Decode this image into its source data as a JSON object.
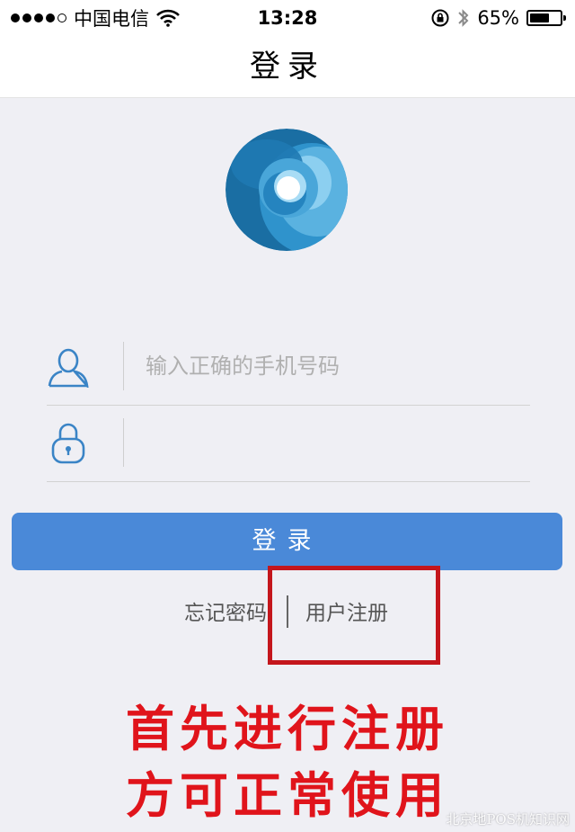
{
  "status_bar": {
    "carrier": "中国电信",
    "time": "13:28",
    "battery_percent": "65%",
    "battery_level": 0.65,
    "icons": [
      "signal-dots",
      "wifi-icon",
      "rotation-lock-icon",
      "bluetooth-icon",
      "battery-icon"
    ]
  },
  "nav": {
    "title": "登录"
  },
  "form": {
    "phone_placeholder": "输入正确的手机号码",
    "phone_value": "",
    "password_value": "",
    "login_label": "登录"
  },
  "links": {
    "forgot": "忘记密码",
    "register": "用户注册"
  },
  "overlay": {
    "caption_line1": "首先进行注册",
    "caption_line2": "方可正常使用",
    "watermark": "北京地POS机知识网"
  },
  "colors": {
    "accent": "#4a89d8",
    "logo_dark": "#1a6ea3",
    "logo_light": "#7cc4ea",
    "highlight": "#c4161c",
    "caption": "#e0141b",
    "background": "#efeff4"
  }
}
